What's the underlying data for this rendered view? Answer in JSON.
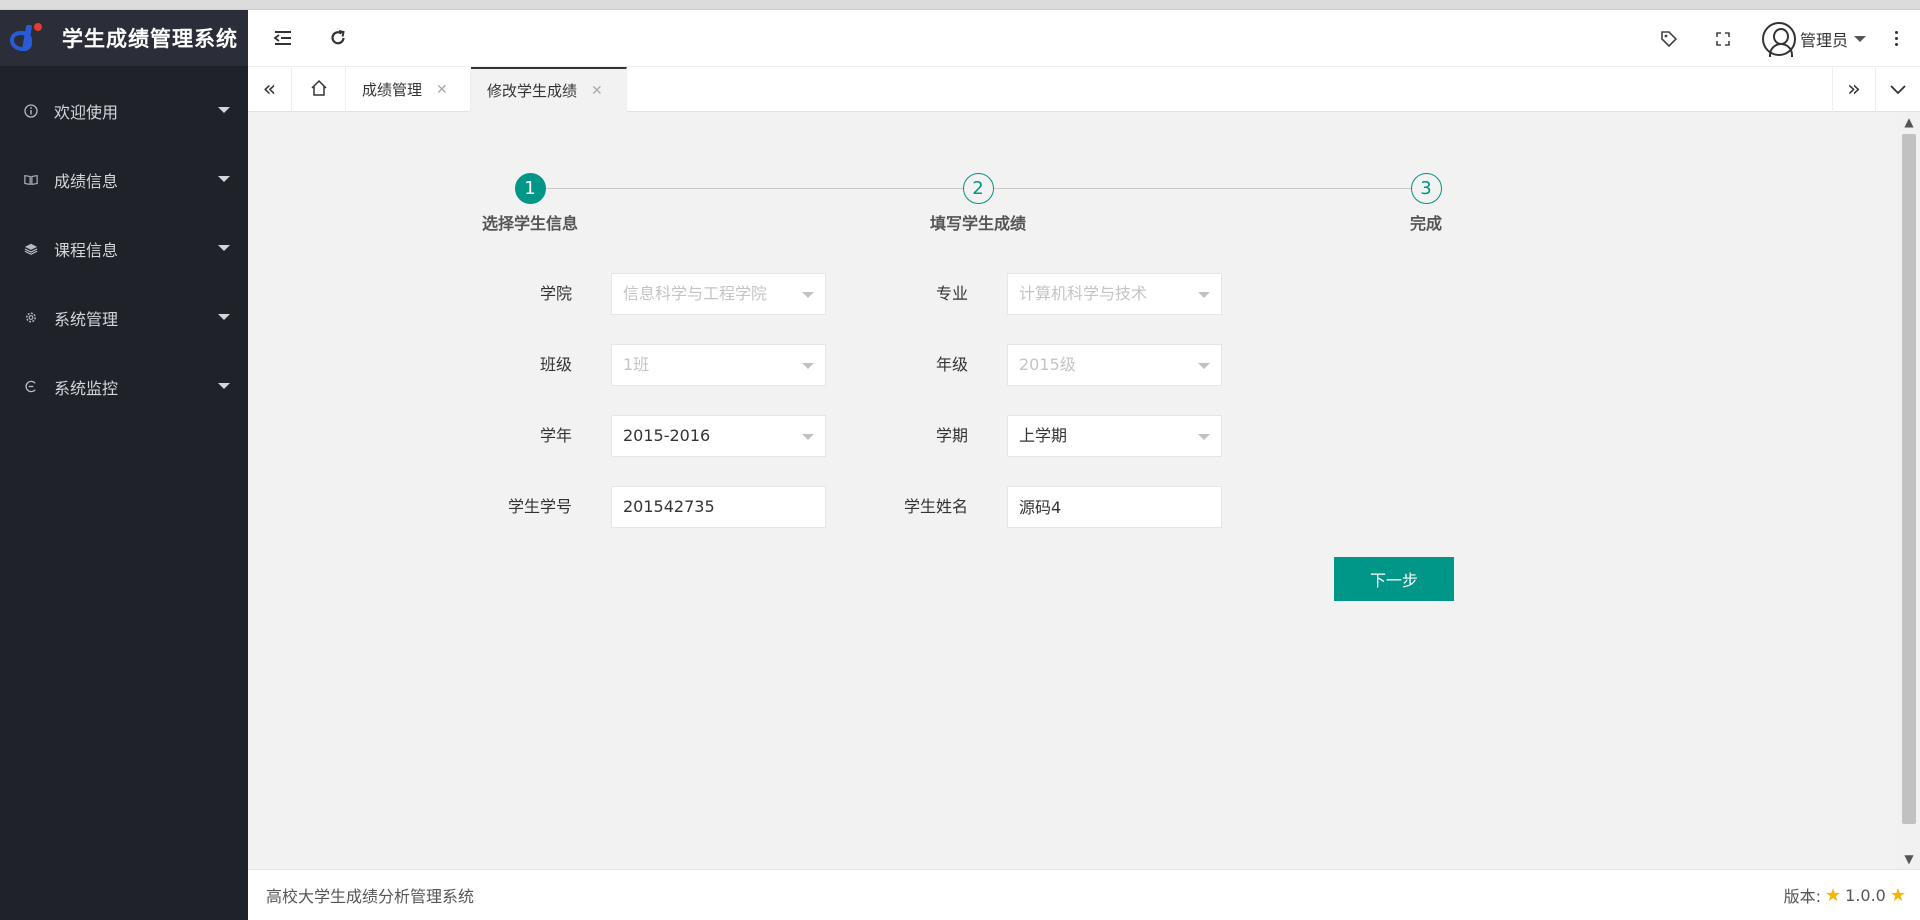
{
  "app": {
    "title": "学生成绩管理系统"
  },
  "sidebar": {
    "items": [
      {
        "label": "欢迎使用",
        "icon": "info-icon"
      },
      {
        "label": "成绩信息",
        "icon": "book-icon"
      },
      {
        "label": "课程信息",
        "icon": "layers-icon"
      },
      {
        "label": "系统管理",
        "icon": "gear-icon"
      },
      {
        "label": "系统监控",
        "icon": "monitor-icon"
      }
    ]
  },
  "header": {
    "user_name": "管理员",
    "icons": [
      "menu-fold-icon",
      "refresh-icon",
      "tag-icon",
      "fullscreen-icon",
      "user-avatar-icon",
      "more-vertical-icon"
    ]
  },
  "tabs": {
    "items": [
      {
        "label": "成绩管理",
        "active": false
      },
      {
        "label": "修改学生成绩",
        "active": true
      }
    ]
  },
  "steps": [
    {
      "number": "1",
      "title": "选择学生信息",
      "status": "active"
    },
    {
      "number": "2",
      "title": "填写学生成绩",
      "status": "pending"
    },
    {
      "number": "3",
      "title": "完成",
      "status": "pending"
    }
  ],
  "form": {
    "college": {
      "label": "学院",
      "value": "信息科学与工程学院",
      "disabled": true
    },
    "major": {
      "label": "专业",
      "value": "计算机科学与技术",
      "disabled": true
    },
    "class": {
      "label": "班级",
      "value": "1班",
      "disabled": true
    },
    "grade": {
      "label": "年级",
      "value": "2015级",
      "disabled": true
    },
    "school_year": {
      "label": "学年",
      "value": "2015-2016"
    },
    "term": {
      "label": "学期",
      "value": "上学期"
    },
    "student_id": {
      "label": "学生学号",
      "value": "201542735"
    },
    "student_name": {
      "label": "学生姓名",
      "value": "源码4"
    },
    "next_label": "下一步"
  },
  "footer": {
    "left": "高校大学生成绩分析管理系统",
    "version_label": "版本:",
    "version": "1.0.0"
  },
  "colors": {
    "accent": "#009688",
    "sidebar_bg": "#20222a",
    "logo_bg": "#2b2e38",
    "star": "#f5b800"
  }
}
